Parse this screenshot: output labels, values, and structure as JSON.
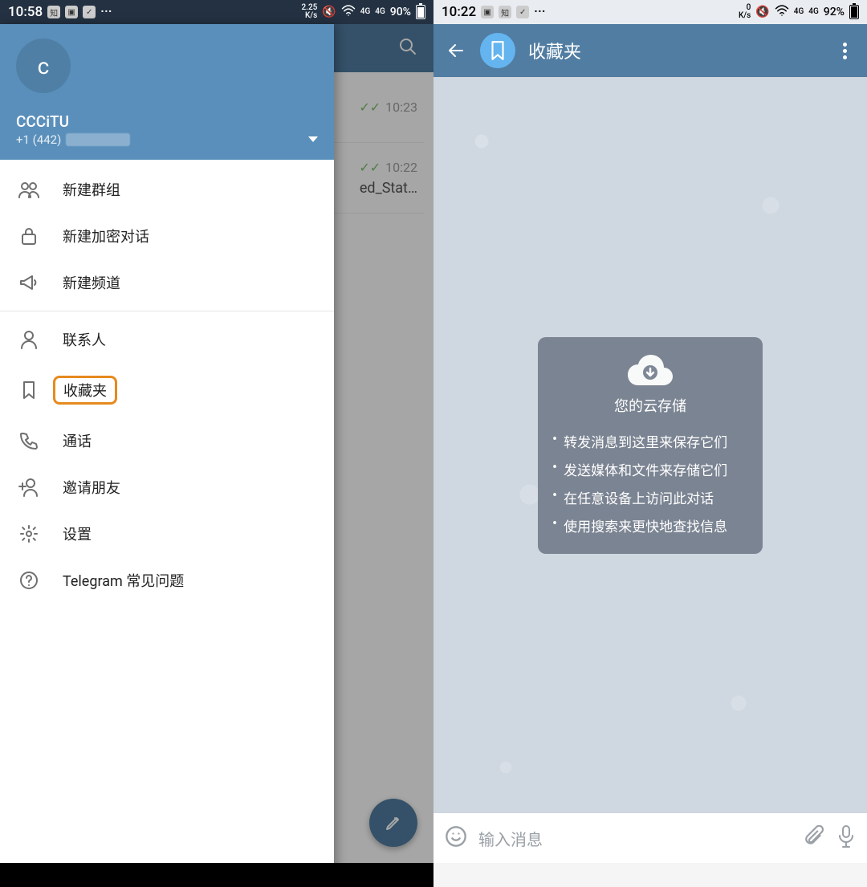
{
  "left": {
    "status": {
      "time": "10:58",
      "net_speed": "2.25",
      "net_unit": "K/s",
      "net_4g": "4G",
      "battery_pct": "90%"
    },
    "chatlist": {
      "items": [
        {
          "time": "10:23",
          "filename": ""
        },
        {
          "time": "10:22",
          "filename": "ed_Stat…"
        }
      ]
    },
    "drawer": {
      "avatar_letter": "c",
      "profile_name": "CCCiTU",
      "profile_phone_prefix": "+1 (442)",
      "menu_groups": [
        [
          {
            "icon": "group",
            "label": "新建群组"
          },
          {
            "icon": "lock",
            "label": "新建加密对话"
          },
          {
            "icon": "megaphone",
            "label": "新建频道"
          }
        ],
        [
          {
            "icon": "person",
            "label": "联系人"
          },
          {
            "icon": "bookmark",
            "label": "收藏夹",
            "highlighted": true
          },
          {
            "icon": "phone",
            "label": "通话"
          },
          {
            "icon": "invite",
            "label": "邀请朋友"
          },
          {
            "icon": "gear",
            "label": "设置"
          },
          {
            "icon": "help",
            "label": "Telegram 常见问题"
          }
        ]
      ]
    }
  },
  "right": {
    "status": {
      "time": "10:22",
      "net_speed": "0",
      "net_unit": "K/s",
      "net_4g": "4G",
      "battery_pct": "92%"
    },
    "toolbar": {
      "title": "收藏夹"
    },
    "cloud_card": {
      "title": "您的云存储",
      "bullets": [
        "转发消息到这里来保存它们",
        "发送媒体和文件来存储它们",
        "在任意设备上访问此对话",
        "使用搜索来更快地查找信息"
      ]
    },
    "input": {
      "placeholder": "输入消息"
    }
  }
}
